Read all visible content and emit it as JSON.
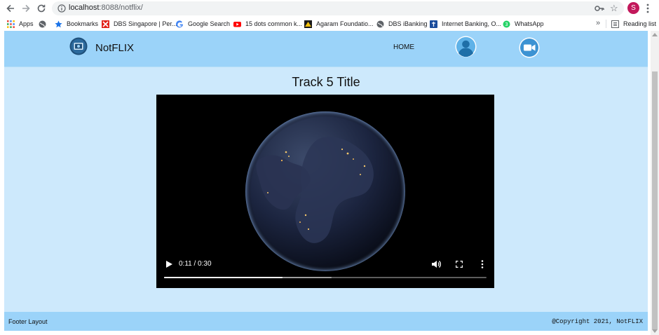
{
  "browser": {
    "url_host": "localhost",
    "url_rest": ":8088/notflix/",
    "profile_initial": "S",
    "icons": [
      "back-icon",
      "forward-icon",
      "reload-icon",
      "info-icon",
      "key-icon",
      "star-icon",
      "kebab-icon"
    ],
    "bookmarks": [
      {
        "label": "Apps",
        "icon": "apps-grid-icon"
      },
      {
        "label": "",
        "icon": "globe-icon"
      },
      {
        "label": "Bookmarks",
        "icon": "bookmark-star-icon"
      },
      {
        "label": "DBS Singapore | Per...",
        "icon": "dbs-icon"
      },
      {
        "label": "Google Search",
        "icon": "google-icon"
      },
      {
        "label": "15 dots common k...",
        "icon": "youtube-icon"
      },
      {
        "label": "Agaram Foundatio...",
        "icon": "agaram-icon"
      },
      {
        "label": "DBS iBanking",
        "icon": "globe-icon"
      },
      {
        "label": "Internet Banking, O...",
        "icon": "bank-icon"
      },
      {
        "label": "WhatsApp",
        "icon": "whatsapp-icon"
      }
    ],
    "more_bookmarks": "»",
    "reading_list": "Reading list"
  },
  "header": {
    "brand": "NotFLIX",
    "home": "HOME",
    "accent": "#9bd3f9"
  },
  "main": {
    "track_title": "Track 5 Title",
    "background": "#cde9fc"
  },
  "player": {
    "time": "0:11 / 0:30",
    "progress_fraction": 0.367,
    "buffered_fraction": 0.52
  },
  "footer": {
    "left": "Footer Layout",
    "right": "@Copyright 2021, NotFLIX"
  }
}
